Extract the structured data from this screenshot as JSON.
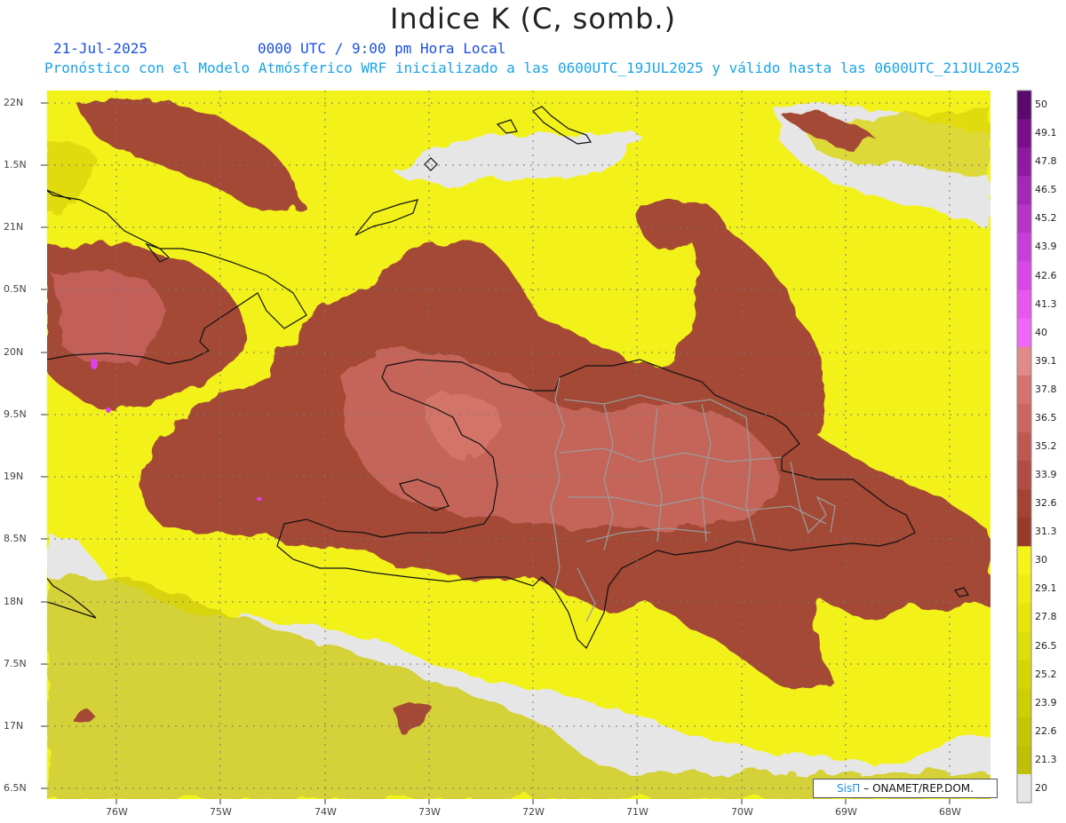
{
  "header": {
    "title": "Indice K (C, somb.)",
    "date": "21-Jul-2025",
    "time": "0000 UTC / 9:00 pm Hora Local",
    "description": "Pronóstico con el Modelo Atmósferico WRF inicializado a las 0600UTC_19JUL2025 y válido hasta las  0600UTC_21JUL2025"
  },
  "map": {
    "lat_labels": [
      "22N",
      "1.5N",
      "21N",
      "0.5N",
      "20N",
      "9.5N",
      "19N",
      "8.5N",
      "18N",
      "7.5N",
      "17N",
      "6.5N"
    ],
    "lon_labels": [
      "76W",
      "75W",
      "74W",
      "73W",
      "72W",
      "71W",
      "70W",
      "69W",
      "68W"
    ],
    "field_colors": {
      "low": "#c8c000",
      "mid": "#f2f21a",
      "high": "#a34a36",
      "very_high": "#d6706a",
      "missing": "#e6e6e6"
    }
  },
  "colorbar": {
    "labels": [
      "50",
      "49.1",
      "47.8",
      "46.5",
      "45.2",
      "43.9",
      "42.6",
      "41.3",
      "40",
      "39.1",
      "37.8",
      "36.5",
      "35.2",
      "33.9",
      "32.6",
      "31.3",
      "30",
      "29.1",
      "27.8",
      "26.5",
      "25.2",
      "23.9",
      "22.6",
      "21.3",
      "20"
    ],
    "colors": [
      "#5a0a6e",
      "#7a0f8a",
      "#8e1aa0",
      "#a22ab6",
      "#b634c8",
      "#c83ed8",
      "#d848e6",
      "#e856f0",
      "#f066f6",
      "#e08a8a",
      "#d67270",
      "#cc6660",
      "#c05852",
      "#b24c44",
      "#a44236",
      "#963a2a",
      "#f4f418",
      "#eded10",
      "#e6e60a",
      "#dede08",
      "#d6d606",
      "#cece05",
      "#c6c604",
      "#bfbf03",
      "#e6e6e6"
    ]
  },
  "credit": {
    "brand": "SisΠ",
    "org": "– ONAMET/REP.DOM."
  }
}
